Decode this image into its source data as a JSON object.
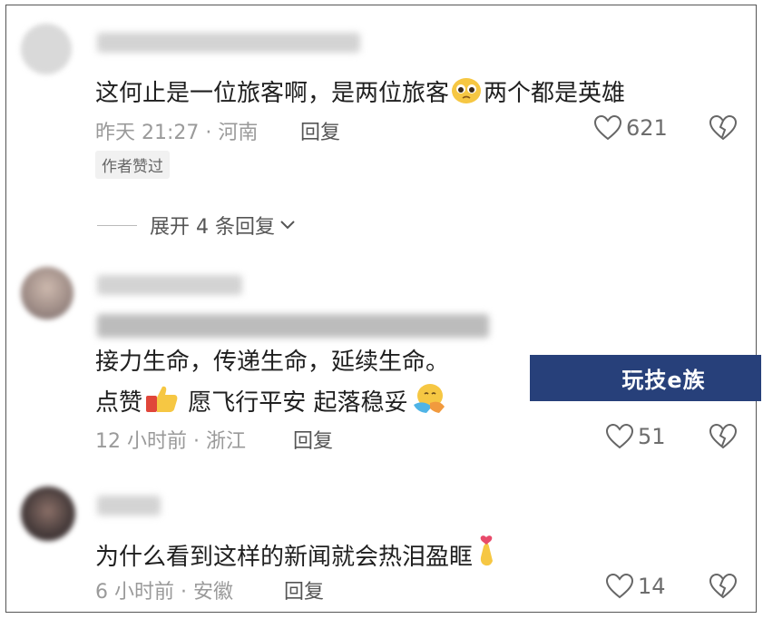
{
  "comments": [
    {
      "text": "这何止是一位旅客啊，是两位旅客",
      "text_after_emoji": "两个都是英雄",
      "emoji": "pleading-face",
      "time": "昨天 21:27",
      "location": "河南",
      "reply_label": "回复",
      "likes": "621",
      "author_tag": "作者赞过"
    },
    {
      "line1": "接力生命，传递生命，延续生命。",
      "line2_a": "点赞",
      "line2_b": "愿飞行平安 起落稳妥",
      "emoji_a": "thumbs-up",
      "emoji_b": "hugging-face",
      "time": "12 小时前",
      "location": "浙江",
      "reply_label": "回复",
      "likes": "51"
    },
    {
      "text": "为什么看到这样的新闻就会热泪盈眶",
      "emoji": "finger-heart",
      "time": "6 小时前",
      "location": "安徽",
      "reply_label": "回复",
      "likes": "14"
    }
  ],
  "expand_replies": "展开 4 条回复",
  "watermark": "玩技e族",
  "colors": {
    "watermark_bg": "#27407a",
    "meta": "#9a9a9a",
    "text": "#1f1f1f"
  }
}
